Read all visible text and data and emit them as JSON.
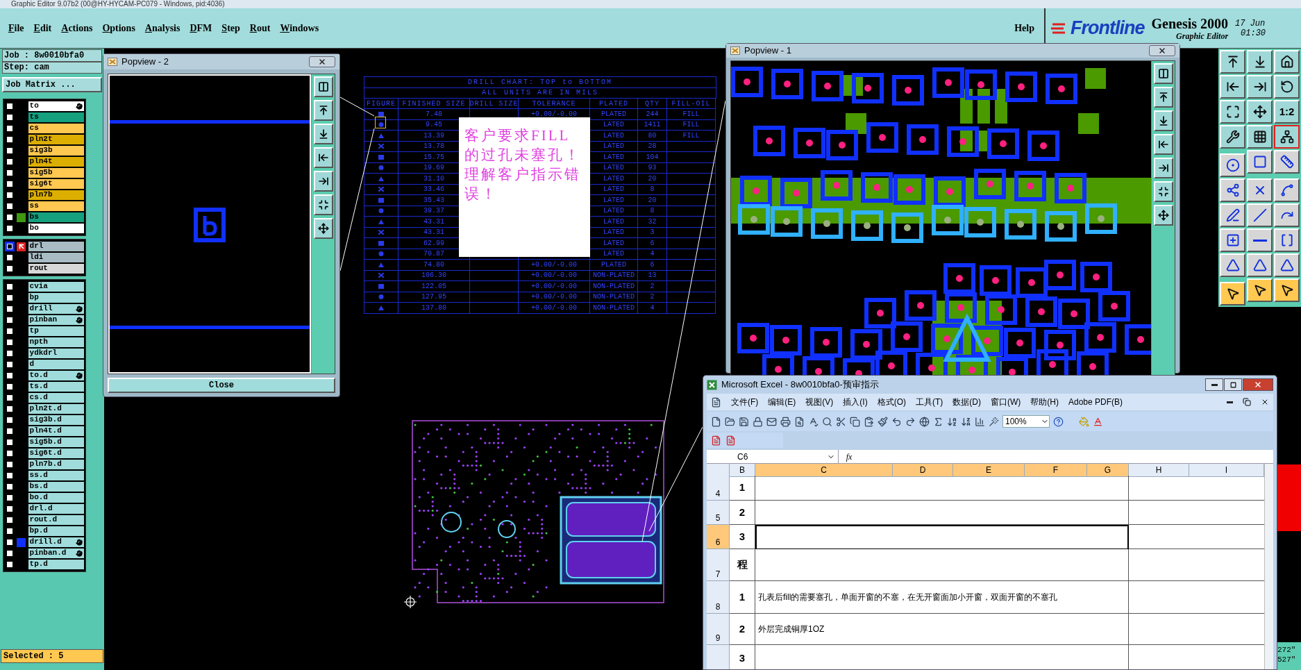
{
  "window": {
    "title": "Graphic Editor 9.07b2 (00@HY-HYCAM-PC079 - Windows, pid:4036)"
  },
  "menu": [
    "File",
    "Edit",
    "Actions",
    "Options",
    "Analysis",
    "DFM",
    "Step",
    "Rout",
    "Windows"
  ],
  "help": "Help",
  "brand": {
    "logo": "Frontline",
    "product": "Genesis 2000",
    "subtitle": "Graphic Editor",
    "date": "17 Jun",
    "time": "01:30"
  },
  "job": {
    "job": "Job : 8w0010bfa0",
    "step": "Step: cam",
    "matrix_button": "Job Matrix ..."
  },
  "layer_groups": [
    {
      "layers": [
        {
          "name": "to",
          "color": "#ffffff",
          "hand": true,
          "selected": false
        },
        {
          "name": "ts",
          "color": "#15a07e",
          "hand": false,
          "selected": false
        },
        {
          "name": "cs",
          "color": "#ffc850",
          "hand": false,
          "selected": false
        },
        {
          "name": "pln2t",
          "color": "#dcae00",
          "hand": false,
          "selected": false
        },
        {
          "name": "sig3b",
          "color": "#ffc850",
          "hand": false,
          "selected": false
        },
        {
          "name": "pln4t",
          "color": "#dcae00",
          "hand": false,
          "selected": false
        },
        {
          "name": "sig5b",
          "color": "#ffc850",
          "hand": false,
          "selected": false
        },
        {
          "name": "sig6t",
          "color": "#ffc850",
          "hand": false,
          "selected": false
        },
        {
          "name": "pln7b",
          "color": "#dcae00",
          "hand": false,
          "selected": false
        },
        {
          "name": "ss",
          "color": "#ffc850",
          "hand": false,
          "selected": false
        },
        {
          "name": "bs",
          "color": "#15a07e",
          "hand": false,
          "selected": false,
          "indicator": {
            "kind": "square",
            "color": "#3e9a10"
          }
        },
        {
          "name": "bo",
          "color": "#ffffff",
          "hand": false,
          "selected": false
        }
      ]
    },
    {
      "layers": [
        {
          "name": "drl",
          "color": "#a9bcc4",
          "hand": false,
          "selected": true,
          "indicator": {
            "kind": "arrow",
            "color": "#e02020"
          }
        },
        {
          "name": "ldi",
          "color": "#a9bcc4",
          "hand": false,
          "selected": false
        },
        {
          "name": "rout",
          "color": "#d8d8d8",
          "hand": false,
          "selected": false
        }
      ]
    },
    {
      "layers": [
        {
          "name": "cvia",
          "color": "#a0dcdc",
          "hand": false,
          "selected": false
        },
        {
          "name": "bp",
          "color": "#a0dcdc",
          "hand": false,
          "selected": false
        },
        {
          "name": "drill",
          "color": "#a0dcdc",
          "hand": true,
          "selected": false
        },
        {
          "name": "pinban",
          "color": "#a0dcdc",
          "hand": true,
          "selected": false
        },
        {
          "name": "tp",
          "color": "#a0dcdc",
          "hand": false,
          "selected": false
        },
        {
          "name": "npth",
          "color": "#a0dcdc",
          "hand": false,
          "selected": false
        },
        {
          "name": "ydkdrl",
          "color": "#a0dcdc",
          "hand": false,
          "selected": false
        },
        {
          "name": "d",
          "color": "#a0dcdc",
          "hand": false,
          "selected": false
        },
        {
          "name": "to.d",
          "color": "#a0dcdc",
          "hand": true,
          "selected": false
        },
        {
          "name": "ts.d",
          "color": "#a0dcdc",
          "hand": false,
          "selected": false
        },
        {
          "name": "cs.d",
          "color": "#a0dcdc",
          "hand": false,
          "selected": false
        },
        {
          "name": "pln2t.d",
          "color": "#a0dcdc",
          "hand": false,
          "selected": false
        },
        {
          "name": "sig3b.d",
          "color": "#a0dcdc",
          "hand": false,
          "selected": false
        },
        {
          "name": "pln4t.d",
          "color": "#a0dcdc",
          "hand": false,
          "selected": false
        },
        {
          "name": "sig5b.d",
          "color": "#a0dcdc",
          "hand": false,
          "selected": false
        },
        {
          "name": "sig6t.d",
          "color": "#a0dcdc",
          "hand": false,
          "selected": false
        },
        {
          "name": "pln7b.d",
          "color": "#a0dcdc",
          "hand": false,
          "selected": false
        },
        {
          "name": "ss.d",
          "color": "#a0dcdc",
          "hand": false,
          "selected": false
        },
        {
          "name": "bs.d",
          "color": "#a0dcdc",
          "hand": false,
          "selected": false
        },
        {
          "name": "bo.d",
          "color": "#a0dcdc",
          "hand": false,
          "selected": false
        },
        {
          "name": "drl.d",
          "color": "#a0dcdc",
          "hand": false,
          "selected": false
        },
        {
          "name": "rout.d",
          "color": "#a0dcdc",
          "hand": false,
          "selected": false
        },
        {
          "name": "bp.d",
          "color": "#a0dcdc",
          "hand": false,
          "selected": false
        },
        {
          "name": "drill.d",
          "color": "#a0dcdc",
          "hand": true,
          "selected": false,
          "indicator": {
            "kind": "square",
            "color": "#1030ff"
          }
        },
        {
          "name": "pinban.d",
          "color": "#a0dcdc",
          "hand": true,
          "selected": false
        },
        {
          "name": "tp.d",
          "color": "#a0dcdc",
          "hand": false,
          "selected": false
        }
      ]
    }
  ],
  "status": "Selected : 5",
  "popview_2": {
    "title": "Popview - 2",
    "close": "Close"
  },
  "popview_1": {
    "title": "Popview - 1"
  },
  "drill_chart": {
    "title": "DRILL CHART: TOP to BOTTOM",
    "subtitle": "ALL UNITS ARE IN MILS",
    "columns": [
      "FIGURE",
      "FINISHED SIZE",
      "DRILL SIZE",
      "TOLERANCE",
      "PLATED",
      "QTY",
      "FILL-OIL"
    ],
    "rows": [
      {
        "finished": "7.48",
        "tolerance": "+0.00/-0.00",
        "plated": "PLATED",
        "qty": "244",
        "fill": "FILL"
      },
      {
        "finished": "9.45",
        "plated": "LATED",
        "qty": "1411",
        "fill": "FILL"
      },
      {
        "finished": "13.39",
        "plated": "LATED",
        "qty": "80",
        "fill": "FILL"
      },
      {
        "finished": "13.78",
        "plated": "LATED",
        "qty": "28"
      },
      {
        "finished": "15.75",
        "plated": "LATED",
        "qty": "104"
      },
      {
        "finished": "19.69",
        "plated": "LATED",
        "qty": "93"
      },
      {
        "finished": "31.10",
        "plated": "LATED",
        "qty": "20"
      },
      {
        "finished": "33.46",
        "plated": "LATED",
        "qty": "8"
      },
      {
        "finished": "35.43",
        "plated": "LATED",
        "qty": "20"
      },
      {
        "finished": "39.37",
        "plated": "LATED",
        "qty": "8"
      },
      {
        "finished": "43.31",
        "plated": "LATED",
        "qty": "32"
      },
      {
        "finished": "43.31",
        "plated": "LATED",
        "qty": "3"
      },
      {
        "finished": "62.99",
        "plated": "LATED",
        "qty": "6"
      },
      {
        "finished": "70.87",
        "plated": "LATED",
        "qty": "4"
      },
      {
        "finished": "74.80",
        "tolerance": "+0.00/-0.00",
        "plated": "PLATED",
        "qty": "6"
      },
      {
        "finished": "106.30",
        "tolerance": "+0.00/-0.00",
        "plated": "NON-PLATED",
        "qty": "13"
      },
      {
        "finished": "122.05",
        "tolerance": "+0.00/-0.00",
        "plated": "NON-PLATED",
        "qty": "2"
      },
      {
        "finished": "127.95",
        "tolerance": "+0.00/-0.00",
        "plated": "NON-PLATED",
        "qty": "2"
      },
      {
        "finished": "137.80",
        "tolerance": "+0.00/-0.00",
        "plated": "NON-PLATED",
        "qty": "4"
      }
    ]
  },
  "note": "客户要求FILL的过孔未塞孔！理解客户指示错误！",
  "tools": [
    {
      "kind": "view",
      "selected": false
    },
    {
      "kind": "view",
      "selected": false
    },
    {
      "kind": "view",
      "selected": false
    },
    {
      "kind": "view",
      "selected": false
    },
    {
      "kind": "view",
      "selected": false
    },
    {
      "kind": "view",
      "selected": false
    },
    {
      "kind": "view",
      "selected": false
    },
    {
      "kind": "view",
      "selected": false
    },
    {
      "kind": "view",
      "selected": false,
      "label": "1:2"
    },
    {
      "kind": "view",
      "selected": false
    },
    {
      "kind": "view",
      "selected": false
    },
    {
      "kind": "view",
      "selected": true
    },
    {
      "kind": "edit",
      "selected": false
    },
    {
      "kind": "edit",
      "selected": false
    },
    {
      "kind": "edit",
      "selected": false
    },
    {
      "kind": "edit",
      "selected": false
    },
    {
      "kind": "edit",
      "selected": false
    },
    {
      "kind": "edit",
      "selected": false
    },
    {
      "kind": "edit",
      "selected": false
    },
    {
      "kind": "edit",
      "selected": false
    },
    {
      "kind": "edit",
      "selected": false
    },
    {
      "kind": "edit",
      "selected": false
    },
    {
      "kind": "edit",
      "selected": false
    },
    {
      "kind": "edit",
      "selected": false
    },
    {
      "kind": "edit",
      "selected": false
    },
    {
      "kind": "edit",
      "selected": false
    },
    {
      "kind": "edit",
      "selected": false
    },
    {
      "kind": "select",
      "selected": false
    },
    {
      "kind": "select",
      "selected": false
    },
    {
      "kind": "select",
      "selected": false
    }
  ],
  "readout": [
    "272\"",
    "527\""
  ],
  "excel": {
    "title": "Microsoft Excel - 8w0010bfa0-预审指示",
    "menu": [
      "文件(F)",
      "编辑(E)",
      "视图(V)",
      "插入(I)",
      "格式(O)",
      "工具(T)",
      "数据(D)",
      "窗口(W)",
      "帮助(H)",
      "Adobe PDF(B)"
    ],
    "zoom": "100%",
    "name_box": "C6",
    "fx": "fx",
    "columns": [
      {
        "label": "B",
        "selected": false
      },
      {
        "label": "C",
        "selected": true
      },
      {
        "label": "D",
        "selected": true
      },
      {
        "label": "E",
        "selected": true
      },
      {
        "label": "F",
        "selected": true
      },
      {
        "label": "G",
        "selected": true
      },
      {
        "label": "H",
        "selected": false
      },
      {
        "label": "I",
        "selected": false
      }
    ],
    "rows": [
      {
        "header": "4",
        "selected": false,
        "b": "1"
      },
      {
        "header": "5",
        "selected": false,
        "b": "2"
      },
      {
        "header": "6",
        "selected": true,
        "b": "3"
      },
      {
        "header": "7",
        "selected": false,
        "b": "程"
      },
      {
        "header": "8",
        "selected": false,
        "b": "1",
        "c": "孔表后fill的需要塞孔，单面开窗的不塞，在无开窗面加小开窗，双面开窗的不塞孔"
      },
      {
        "header": "9",
        "selected": false,
        "b": "2",
        "c": "外层完成铜厚1OZ"
      },
      {
        "selected": false,
        "b": "3"
      }
    ]
  }
}
